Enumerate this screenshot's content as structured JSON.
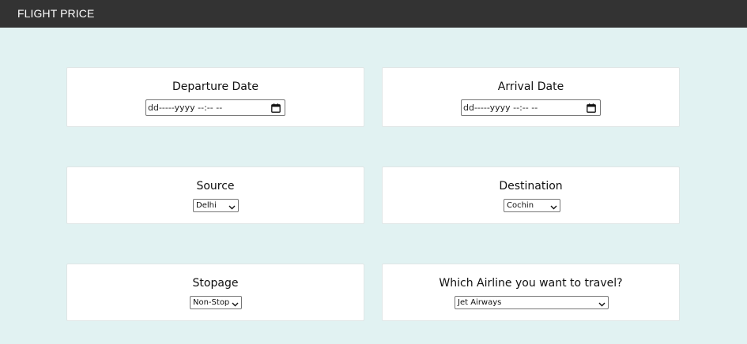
{
  "header": {
    "title": "FLIGHT PRICE"
  },
  "cards": {
    "departure": {
      "label": "Departure Date",
      "placeholder": "dd-----yyyy --:-- --"
    },
    "arrival": {
      "label": "Arrival Date",
      "placeholder": "dd-----yyyy --:-- --"
    },
    "source": {
      "label": "Source",
      "selected": "Delhi"
    },
    "destination": {
      "label": "Destination",
      "selected": "Cochin"
    },
    "stopage": {
      "label": "Stopage",
      "selected": "Non-Stop"
    },
    "airline": {
      "label": "Which Airline you want to travel?",
      "selected": "Jet Airways"
    }
  },
  "icons": {
    "calendar": "calendar-icon",
    "dropdown": "chevron-down-icon"
  },
  "colors": {
    "page_background": "#e1f2f2",
    "topbar": "#333333",
    "card": "#ffffff"
  }
}
